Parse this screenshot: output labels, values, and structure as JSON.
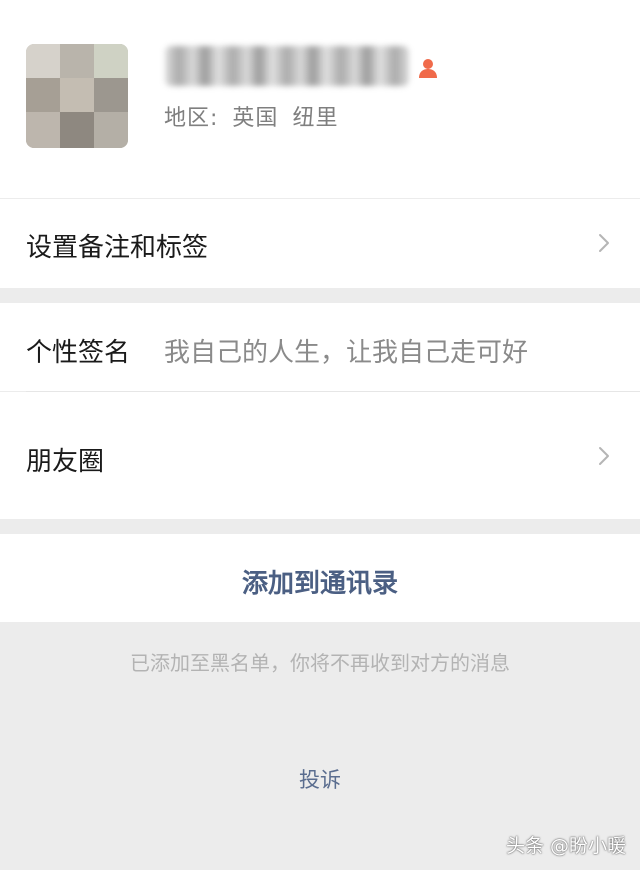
{
  "profile": {
    "avatar_icon": "blurred-profile-photo",
    "name_obscured": true,
    "gender_icon": "person-icon",
    "gender_color": "#f06a4a",
    "region_label": "地区:",
    "region_country": "英国",
    "region_city": "纽里"
  },
  "remarks": {
    "label": "设置备注和标签",
    "icon": "chevron-right-icon"
  },
  "signature": {
    "label": "个性签名",
    "value": "我自己的人生，让我自己走可好"
  },
  "moments": {
    "label": "朋友圈",
    "icon": "chevron-right-icon"
  },
  "actions": {
    "add_contact_label": "添加到通讯录",
    "add_contact_color": "#4b5f83",
    "blacklist_notice": "已添加至黑名单，你将不再收到对方的消息",
    "complain_label": "投诉",
    "complain_color": "#5a6d8f"
  },
  "watermark": {
    "text": "头条 @盼小暖"
  }
}
